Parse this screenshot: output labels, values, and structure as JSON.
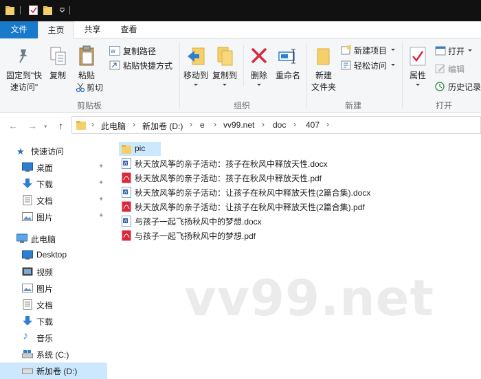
{
  "titlebar": {
    "icons": [
      "folder-icon",
      "properties-icon",
      "new-folder-icon",
      "customize-qa-icon"
    ]
  },
  "ribbon_tabs": [
    {
      "label": "文件",
      "active": false
    },
    {
      "label": "主页",
      "active": true
    },
    {
      "label": "共享",
      "active": false
    },
    {
      "label": "查看",
      "active": false
    }
  ],
  "ribbon": {
    "clipboard": {
      "group_label": "剪贴板",
      "pin_quick_access": "固定到\"快\n速访问\"",
      "copy": "复制",
      "paste": "粘贴",
      "copy_path": "复制路径",
      "paste_shortcut": "粘贴快捷方式",
      "cut": "剪切"
    },
    "organize": {
      "group_label": "组织",
      "move_to": "移动到",
      "copy_to": "复制到",
      "delete": "删除",
      "rename": "重命名"
    },
    "new": {
      "group_label": "新建",
      "new_folder": "新建\n文件夹",
      "new_item": "新建项目",
      "easy_access": "轻松访问"
    },
    "open": {
      "group_label": "打开",
      "properties": "属性",
      "open": "打开",
      "edit": "编辑",
      "history": "历史记录"
    }
  },
  "address": {
    "crumbs": [
      "此电脑",
      "新加卷 (D:)",
      "e",
      "vv99.net",
      "doc",
      "407"
    ]
  },
  "nav": {
    "quick_access": "快速访问",
    "quick_items": [
      "桌面",
      "下载",
      "文档",
      "图片"
    ],
    "this_pc": "此电脑",
    "pc_items": [
      "Desktop",
      "视频",
      "图片",
      "文档",
      "下载",
      "音乐",
      "系统 (C:)",
      "新加卷 (D:)"
    ]
  },
  "files": [
    {
      "name": "pic",
      "type": "folder"
    },
    {
      "name": "秋天放风筝的亲子活动：孩子在秋风中释放天性.docx",
      "type": "docx"
    },
    {
      "name": "秋天放风筝的亲子活动：孩子在秋风中释放天性.pdf",
      "type": "pdf"
    },
    {
      "name": "秋天放风筝的亲子活动：让孩子在秋风中释放天性(2篇合集).docx",
      "type": "docx"
    },
    {
      "name": "秋天放风筝的亲子活动：让孩子在秋风中释放天性(2篇合集).pdf",
      "type": "pdf"
    },
    {
      "name": "与孩子一起飞扬秋风中的梦想.docx",
      "type": "docx"
    },
    {
      "name": "与孩子一起飞扬秋风中的梦想.pdf",
      "type": "pdf"
    }
  ],
  "watermark": "vv99.net",
  "colors": {
    "accent": "#1979ca",
    "selection": "#cce8ff",
    "folder": "#f4cf6a",
    "pdf": "#d9283a",
    "word": "#2b579a"
  }
}
